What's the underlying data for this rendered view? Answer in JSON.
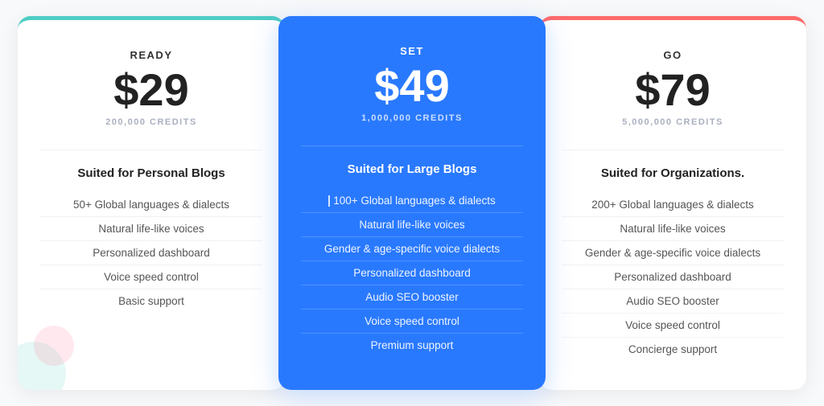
{
  "plans": [
    {
      "id": "ready",
      "name": "READY",
      "price": "$29",
      "credits": "200,000 CREDITS",
      "tagline": "Suited for Personal Blogs",
      "featured": false,
      "type": "ready",
      "features": [
        "50+ Global languages & dialects",
        "Natural life-like voices",
        "Personalized dashboard",
        "Voice speed control",
        "Basic support"
      ]
    },
    {
      "id": "set",
      "name": "SET",
      "price": "$49",
      "credits": "1,000,000 CREDITS",
      "tagline": "Suited for Large Blogs",
      "featured": true,
      "type": "featured",
      "features": [
        "100+ Global languages & dialects",
        "Natural life-like voices",
        "Gender & age-specific voice dialects",
        "Personalized dashboard",
        "Audio SEO booster",
        "Voice speed control",
        "Premium support"
      ]
    },
    {
      "id": "go",
      "name": "GO",
      "price": "$79",
      "credits": "5,000,000 CREDITS",
      "tagline": "Suited for Organizations.",
      "featured": false,
      "type": "go",
      "features": [
        "200+ Global languages & dialects",
        "Natural life-like voices",
        "Gender & age-specific voice dialects",
        "Personalized dashboard",
        "Audio SEO booster",
        "Voice speed control",
        "Concierge support"
      ]
    }
  ]
}
